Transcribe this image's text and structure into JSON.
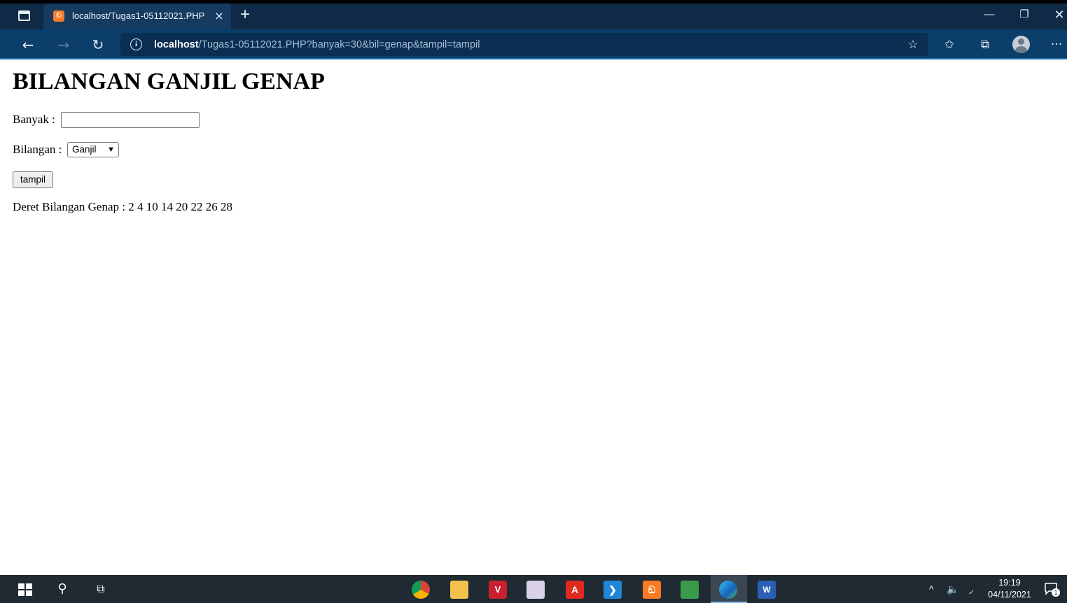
{
  "browser": {
    "tab_title": "localhost/Tugas1-05112021.PHP",
    "tab_close": "×",
    "new_tab": "+",
    "url_host": "localhost",
    "url_path": "/Tugas1-05112021.PHP?banyak=30&bil=genap&tampil=tampil",
    "icons": [
      "tab-actions-icon",
      "back-icon",
      "forward-icon",
      "refresh-icon",
      "site-info-icon",
      "add-favorite-icon",
      "favorites-icon",
      "collections-icon",
      "profile-icon",
      "more-icon",
      "minimize-icon",
      "restore-icon",
      "close-icon"
    ]
  },
  "page": {
    "title": "BILANGAN GANJIL GENAP",
    "banyak_label": "Banyak :",
    "banyak_value": "",
    "bilangan_label": "Bilangan :",
    "bilangan_selected": "Ganjil",
    "submit_label": "tampil",
    "result_text": "Deret Bilangan Genap : 2 4 10 14 20 22 26 28"
  },
  "taskbar": {
    "clock_time": "19:19",
    "clock_date": "04/11/2021",
    "notification_count": "1",
    "apps": [
      "chrome",
      "file-explorer",
      "vivaldi",
      "anime-app",
      "acrobat",
      "vscode",
      "xampp",
      "sublime",
      "edge",
      "word"
    ]
  }
}
